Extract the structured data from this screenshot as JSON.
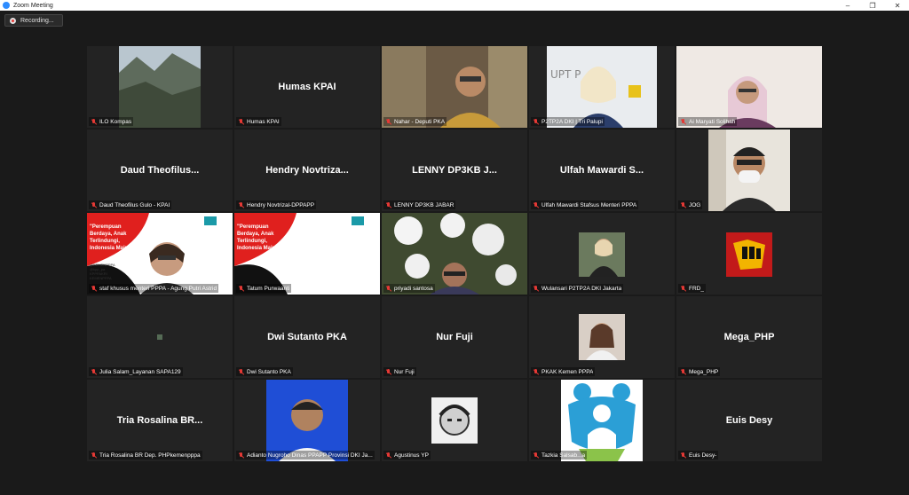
{
  "window": {
    "title": "Zoom Meeting",
    "minimize": "–",
    "maximize": "❐",
    "close": "✕"
  },
  "recording": {
    "label": "Recording..."
  },
  "colors": {
    "accent": "#2d8cff",
    "mic_muted": "#e53935",
    "active_speaker": "#c8e04a"
  },
  "tiles": [
    {
      "name": "ILO Kompas",
      "big": ""
    },
    {
      "name": "Humas KPAI",
      "big": "Humas KPAI"
    },
    {
      "name": "Nahar - Deputi PKA",
      "big": ""
    },
    {
      "name": "P2TP2A DKI | Tri Palupi",
      "big": ""
    },
    {
      "name": "Ai Maryati Solihah",
      "big": ""
    },
    {
      "name": "Daud Theofilus Gulo - KPAI",
      "big": "Daud  Theofilus..."
    },
    {
      "name": "Hendry Novtrizal-DPPAPP",
      "big": "Hendry  Novtriza..."
    },
    {
      "name": "LENNY DP3KB JABAR",
      "big": "LENNY  DP3KB  J..."
    },
    {
      "name": "Ulfah Mawardi Stafsus Menteri PPPA",
      "big": "Ulfah  Mawardi  S..."
    },
    {
      "name": "JOG",
      "big": ""
    },
    {
      "name": "staf khusus menteri PPPA - Agung Putri Astrid",
      "big": ""
    },
    {
      "name": "Tatum Purwaanti",
      "big": ""
    },
    {
      "name": "priyadi santosa",
      "big": ""
    },
    {
      "name": "Wulansari P2TP2A DKI Jakarta",
      "big": ""
    },
    {
      "name": "FRD_",
      "big": ""
    },
    {
      "name": "Julia Salam_Layanan SAPA129",
      "big": ""
    },
    {
      "name": "Dwi Sutanto PKA",
      "big": "Dwi Sutanto PKA"
    },
    {
      "name": "Nur Fuji",
      "big": "Nur Fuji"
    },
    {
      "name": "PKAK Kemen PPPA",
      "big": ""
    },
    {
      "name": "Mega_PHP",
      "big": "Mega_PHP"
    },
    {
      "name": "Tria Rosalina BR Dep. PHPkemenpppa",
      "big": "Tria  Rosalina  BR..."
    },
    {
      "name": "Adianto Nugroho Dinas PPAPP Provinsi DKI Ja...",
      "big": ""
    },
    {
      "name": "Agustinus YP",
      "big": ""
    },
    {
      "name": "Tazkia Salsab...a",
      "big": ""
    },
    {
      "name": "Euis Desy-",
      "big": "Euis Desy"
    }
  ],
  "slides": {
    "quote": "\"Perempuan Berdaya, Anak Terlindungi, Indonesia Maju\"",
    "social": [
      "@KEMENPPPA",
      "@kpp_pa",
      "KPPPAKRI",
      "KEMENPPPA"
    ]
  }
}
